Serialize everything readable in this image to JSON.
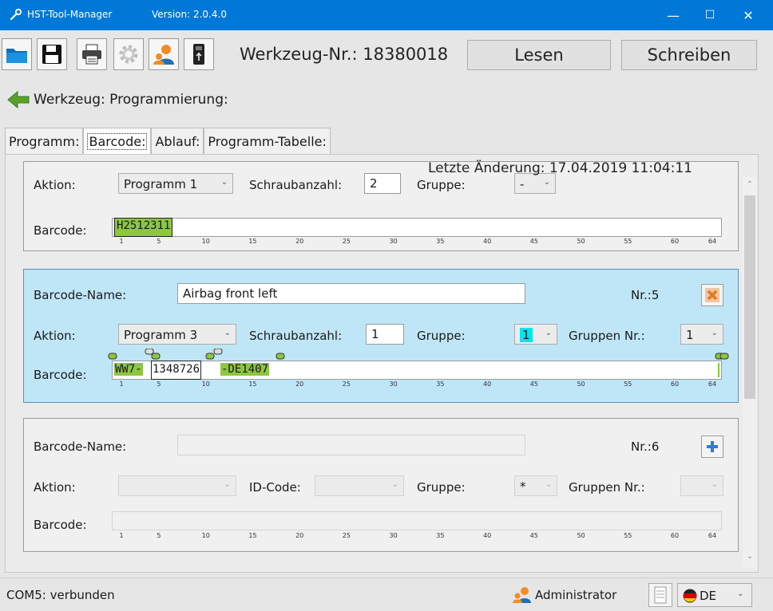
{
  "window": {
    "title": "HST-Tool-Manager",
    "version": "Version: 2.0.4.0",
    "minimize": "—",
    "maximize": "☐",
    "close": "✕"
  },
  "toolbar": {
    "tool_number": "Werkzeug-Nr.: 18380018",
    "read_label": "Lesen",
    "write_label": "Schreiben"
  },
  "breadcrumb": {
    "title": "Werkzeug: Programmierung:"
  },
  "tabs": [
    {
      "label": "Programm:"
    },
    {
      "label": "Barcode:"
    },
    {
      "label": "Ablauf:"
    },
    {
      "label": "Programm-Tabelle:"
    }
  ],
  "last_change": "Letzte Änderung:  17.04.2019  11:04:11",
  "ruler": [
    "1",
    "5",
    "10",
    "15",
    "20",
    "25",
    "30",
    "35",
    "40",
    "45",
    "50",
    "55",
    "60",
    "64"
  ],
  "panel_top": {
    "action_label": "Aktion:",
    "action_value": "Programm 1",
    "screw_label": "Schraubanzahl:",
    "screw_value": "2",
    "group_label": "Gruppe:",
    "group_value": "-",
    "barcode_label": "Barcode:",
    "barcode_value": "H2512311"
  },
  "panel_active": {
    "name_label": "Barcode-Name:",
    "name_value": "Airbag front left",
    "nr_label": "Nr.:5",
    "action_label": "Aktion:",
    "action_value": "Programm 3",
    "screw_label": "Schraubanzahl:",
    "screw_value": "1",
    "group_label": "Gruppe:",
    "group_value": "1",
    "group_nr_label": "Gruppen Nr.:",
    "group_nr_value": "1",
    "barcode_label": "Barcode:",
    "barcode_seg1": "WW7-",
    "barcode_seg2": "1348726",
    "barcode_seg3": "-DE1407"
  },
  "panel_new": {
    "name_label": "Barcode-Name:",
    "nr_label": "Nr.:6",
    "action_label": "Aktion:",
    "id_label": "ID-Code:",
    "group_label": "Gruppe:",
    "group_value": "*",
    "group_nr_label": "Gruppen Nr.:",
    "barcode_label": "Barcode:"
  },
  "status": {
    "connection": "COM5: verbunden",
    "user": "Administrator",
    "language": "DE"
  },
  "colors": {
    "titlebar": "#0078d7",
    "active_panel": "#bfe6f7",
    "barcode_highlight": "#8dc63f",
    "group_highlight": "#00e5ee",
    "delete_icon": "#e07b1e",
    "add_icon": "#2a7fd4"
  }
}
